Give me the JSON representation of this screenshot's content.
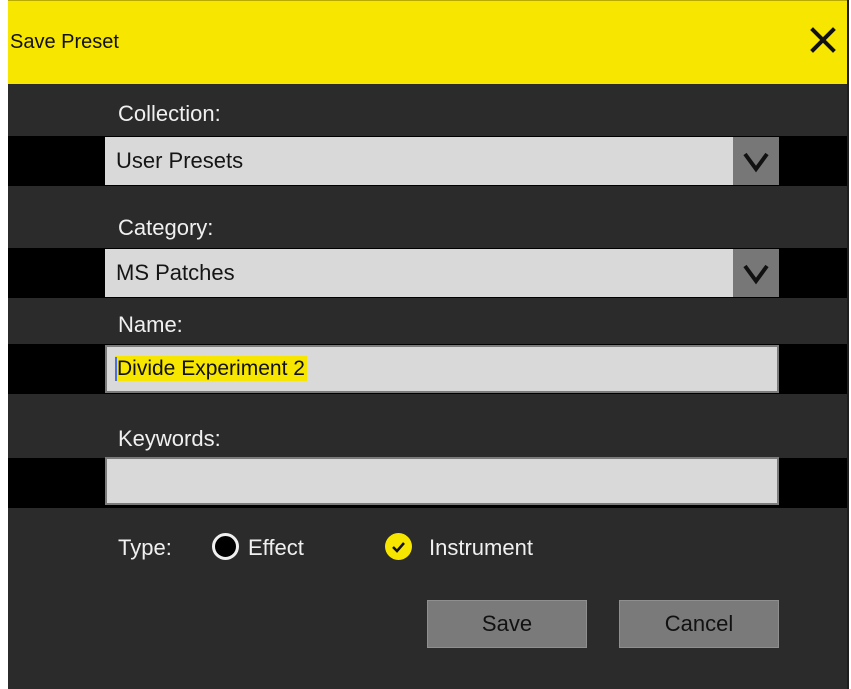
{
  "window": {
    "title": "Save Preset"
  },
  "form": {
    "collection_label": "Collection:",
    "collection_value": "User Presets",
    "category_label": "Category:",
    "category_value": "MS Patches",
    "name_label": "Name:",
    "name_value": "Divide Experiment 2",
    "keywords_label": "Keywords:",
    "keywords_value": ""
  },
  "type": {
    "label": "Type:",
    "options": [
      {
        "label": "Effect",
        "selected": false
      },
      {
        "label": "Instrument",
        "selected": true
      }
    ]
  },
  "buttons": {
    "save": "Save",
    "cancel": "Cancel"
  },
  "colors": {
    "accent": "#f7e600",
    "background": "#2b2b2b",
    "field": "#d9d9d9",
    "button": "#7a7a7a"
  },
  "icons": {
    "close": "close-icon",
    "dropdown": "chevron-down-icon",
    "selected": "check-icon"
  }
}
